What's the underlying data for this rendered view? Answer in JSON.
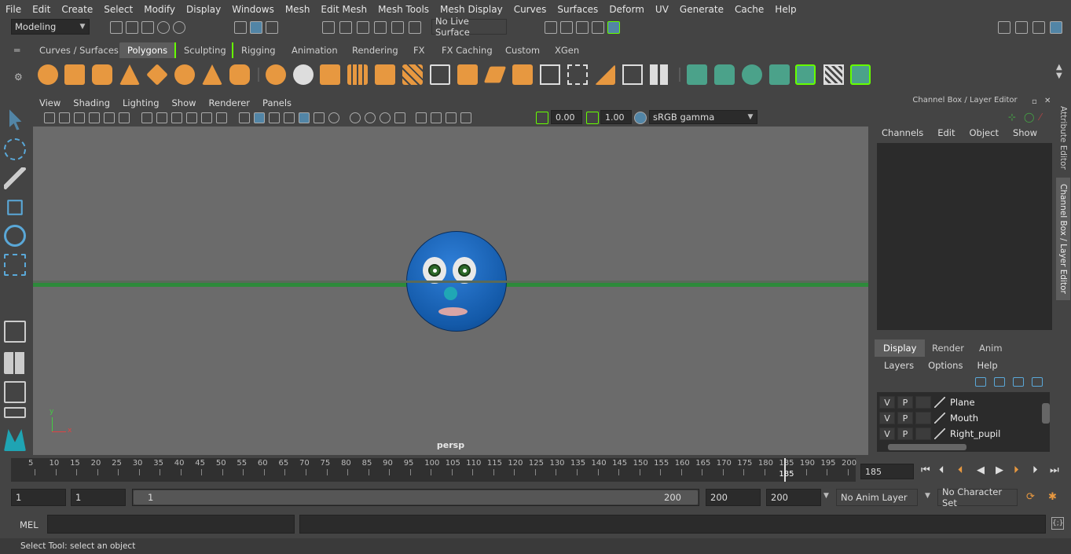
{
  "menubar": [
    "File",
    "Edit",
    "Create",
    "Select",
    "Modify",
    "Display",
    "Windows",
    "Mesh",
    "Edit Mesh",
    "Mesh Tools",
    "Mesh Display",
    "Curves",
    "Surfaces",
    "Deform",
    "UV",
    "Generate",
    "Cache",
    "Help"
  ],
  "status": {
    "mode": "Modeling",
    "live_surface": "No Live Surface"
  },
  "shelf_tabs": [
    "Curves / Surfaces",
    "Polygons",
    "Sculpting",
    "Rigging",
    "Animation",
    "Rendering",
    "FX",
    "FX Caching",
    "Custom",
    "XGen"
  ],
  "viewport": {
    "menu": [
      "View",
      "Shading",
      "Lighting",
      "Show",
      "Renderer",
      "Panels"
    ],
    "exposure": "0.00",
    "gamma": "1.00",
    "colorspace": "sRGB gamma",
    "camera": "persp",
    "axis_x": "x",
    "axis_y": "y"
  },
  "channel_box": {
    "title": "Channel Box / Layer Editor",
    "menu": [
      "Channels",
      "Edit",
      "Object",
      "Show"
    ]
  },
  "layer_editor": {
    "tabs": [
      "Display",
      "Render",
      "Anim"
    ],
    "menu": [
      "Layers",
      "Options",
      "Help"
    ],
    "layers": [
      {
        "v": "V",
        "p": "P",
        "name": "Plane"
      },
      {
        "v": "V",
        "p": "P",
        "name": "Mouth"
      },
      {
        "v": "V",
        "p": "P",
        "name": "Right_pupil"
      }
    ]
  },
  "side_tabs": {
    "attribute_editor": "Attribute Editor",
    "channel_box": "Channel Box / Layer Editor"
  },
  "timeline": {
    "ticks": [
      "5",
      "10",
      "15",
      "20",
      "25",
      "30",
      "35",
      "40",
      "45",
      "50",
      "55",
      "60",
      "65",
      "70",
      "75",
      "80",
      "85",
      "90",
      "95",
      "100",
      "105",
      "110",
      "115",
      "120",
      "125",
      "130",
      "135",
      "140",
      "145",
      "150",
      "155",
      "160",
      "165",
      "170",
      "175",
      "180",
      "185",
      "190",
      "195",
      "200"
    ],
    "current": "185",
    "current_field": "185"
  },
  "range": {
    "start": "1",
    "playback_start": "1",
    "slider_start": "1",
    "slider_end": "200",
    "playback_end": "200",
    "end": "200",
    "anim_layer": "No Anim Layer",
    "char_set": "No Character Set"
  },
  "cmd": {
    "label": "MEL"
  },
  "help_line": "Select Tool: select an object",
  "colors": {
    "accent": "#5285a6",
    "shelf_orange": "#e79840",
    "shelf_teal": "#4ba28a",
    "ground": "#2d8a3a",
    "head": "#1a67c0"
  }
}
